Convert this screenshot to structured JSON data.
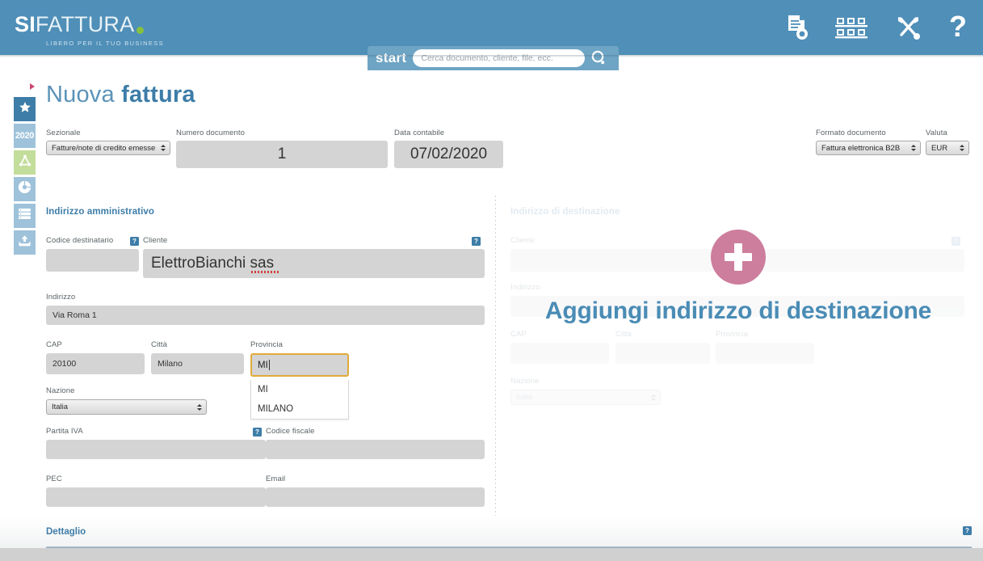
{
  "header": {
    "logo_primary": "SI",
    "logo_secondary": "FATTURA",
    "tagline": "LIBERO PER IL TUO BUSINESS",
    "brand_color": "#4f8fb8",
    "accent_green": "#86c040",
    "search": {
      "label": "start",
      "placeholder": "Cerca documento, cliente, file, ecc.",
      "value": ""
    },
    "icons": [
      {
        "name": "document-search-icon",
        "title": "Documenti"
      },
      {
        "name": "warehouse-icon",
        "title": "Magazzino"
      },
      {
        "name": "tools-icon",
        "title": "Strumenti"
      },
      {
        "name": "help-icon",
        "title": "Aiuto"
      }
    ]
  },
  "sidebar": {
    "items": [
      {
        "name": "favorites",
        "icon": "star-icon",
        "label": "",
        "active": true
      },
      {
        "name": "year",
        "icon": "year-label",
        "label": "2020",
        "active": false
      },
      {
        "name": "share",
        "icon": "network-triangle-icon",
        "label": "",
        "active": false
      },
      {
        "name": "reports",
        "icon": "pie-chart-icon",
        "label": "",
        "active": false
      },
      {
        "name": "archive",
        "icon": "server-list-icon",
        "label": "",
        "active": false
      },
      {
        "name": "upload",
        "icon": "upload-icon",
        "label": "",
        "active": false
      }
    ]
  },
  "page": {
    "title_light": "Nuova",
    "title_bold": "fattura"
  },
  "doc_header": {
    "sezionale": {
      "label": "Sezionale",
      "value": "Fatture/note di credito emesse"
    },
    "numero": {
      "label": "Numero documento",
      "value": "1"
    },
    "data": {
      "label": "Data contabile",
      "value": "07/02/2020"
    },
    "formato": {
      "label": "Formato documento",
      "value": "Fattura elettronica B2B"
    },
    "valuta": {
      "label": "Valuta",
      "value": "EUR"
    }
  },
  "admin_address": {
    "section_title": "Indirizzo amministrativo",
    "codice_destinatario": {
      "label": "Codice destinatario",
      "value": "",
      "help": "?"
    },
    "cliente": {
      "label": "Cliente",
      "value": "ElettroBianchi sas",
      "help": "?"
    },
    "indirizzo": {
      "label": "Indirizzo",
      "value": "Via Roma 1"
    },
    "cap": {
      "label": "CAP",
      "value": "20100"
    },
    "citta": {
      "label": "Città",
      "value": "Milano"
    },
    "provincia": {
      "label": "Provincia",
      "value": "MI"
    },
    "nazione": {
      "label": "Nazione",
      "value": "Italia"
    },
    "partita_iva": {
      "label": "Partita IVA",
      "value": "",
      "help": "?"
    },
    "codice_fiscale": {
      "label": "Codice fiscale",
      "value": ""
    },
    "pec": {
      "label": "PEC",
      "value": ""
    },
    "email": {
      "label": "Email",
      "value": ""
    }
  },
  "autocomplete": {
    "options": [
      "MI",
      "MILANO"
    ]
  },
  "dest_address": {
    "section_title": "Indirizzo di destinazione",
    "cliente": {
      "label": "Cliente",
      "value": "",
      "help": "?"
    },
    "indirizzo": {
      "label": "Indirizzo",
      "value": ""
    },
    "cap": {
      "label": "CAP",
      "value": ""
    },
    "citta": {
      "label": "Città",
      "value": ""
    },
    "provincia": {
      "label": "Provincia",
      "value": ""
    },
    "nazione": {
      "label": "Nazione",
      "value": "Italia"
    },
    "add_overlay": {
      "plus": "+",
      "text": "Aggiungi indirizzo di destinazione",
      "circle_color": "#cd7e9c",
      "text_color": "#4a8cb5"
    }
  },
  "footer": {
    "dettaglio_label": "Dettaglio",
    "help": "?"
  }
}
